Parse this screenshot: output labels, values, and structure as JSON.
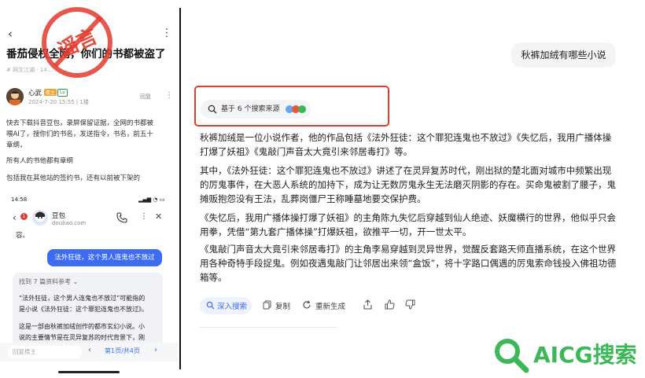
{
  "left": {
    "back_icon": "chevron-left-icon",
    "more_icon": "more-vertical-icon",
    "article_title": "番茄侵权全网，你们的书都被盗了",
    "article_meta": "# 网文江湖 · 14…",
    "stamp_text": "谣言",
    "author": {
      "name": "心武",
      "badge": "楼主",
      "badge2": "Lv",
      "time": "2024-7-20 15:55 | 1楼"
    },
    "reply_label": "回复",
    "body_lines": [
      "快去下载抖音豆包，录屏保留证据，全网的书都被",
      "喂AI了，搜你们的书名，发送指令，书名，前五十",
      "章纲，",
      "所有人的书他都有章纲",
      "包括我在其他站的签约书，还有以前被下架的"
    ],
    "chat": {
      "status_time": "14:58",
      "status_icons": "▂▄▆ ◔ ▭",
      "back_icon": "chevron-left-icon",
      "unread": "1",
      "bot_name": "豆包",
      "bot_domain": "doubao.com",
      "snippet": "容。",
      "user_msg": "法外狂徒，这个男人连鬼也不放过",
      "ref_title": "找到 7 篇资料参考 ⌄",
      "ref_lines": [
        "“法外狂徒，这个男人连鬼也不放过”可能指的",
        "是小说《法外狂徒：这个罪犯连鬼也不放过》。",
        "",
        "这是一部由秋裤加绒创作的都市玄幻小说。小",
        "说的主要情节是在灵异复苏的时代背景下，刚"
      ],
      "reply_placeholder": "回复楼主",
      "page_label": "第1页/共4页"
    }
  },
  "right": {
    "question": "秋裤加绒有哪些小说",
    "sources_label": "基于 6 个搜索来源",
    "answer": [
      "秋裤加绒是一位小说作者，他的作品包括《法外狂徒：这个罪犯连鬼也不放过》《失忆后，我用广播体操打爆了妖祖》《鬼敲门声音太大竟引来邻居毒打》等。",
      "其中，《法外狂徒：这个罪犯连鬼也不放过》讲述了在灵异复苏时代，刚出狱的楚北面对城市中频繁出现的厉鬼事件，在大恶人系统的加持下，成为让无数厉鬼永生无法磨灭阴影的存在。买命鬼被割了腰子，鬼摊贩抱怨没有王法，乱葬岗僵尸王称睡墓地要交保护费。",
      "《失忆后，我用广播体操打爆了妖祖》的主角陈九失忆后穿越到仙人绝迹、妖魔横行的世界，他似乎只会用拳，凭借“第九套广播体操”打爆妖祖，欲推平一切，开一世太平。",
      "《鬼敲门声音太大竟引来邻居毒打》的主角李易穿越到灵异世界，觉醒反套路天师直播系统，在这个世界用各种奇特手段捉鬼。例如夜遇鬼敲门让邻居出来领“盒饭”，将十字路口偶遇的厉鬼索命钱投入佛祖功德箱等。"
    ],
    "actions": {
      "deep": "深入搜索",
      "copy": "复制",
      "regen": "重新生成"
    }
  },
  "watermark": "AICG搜索",
  "colors": {
    "accent": "#3d6cf2",
    "highlight_box": "#e23b2e",
    "stamp": "#e23b2e",
    "watermark": "#3cb858"
  }
}
